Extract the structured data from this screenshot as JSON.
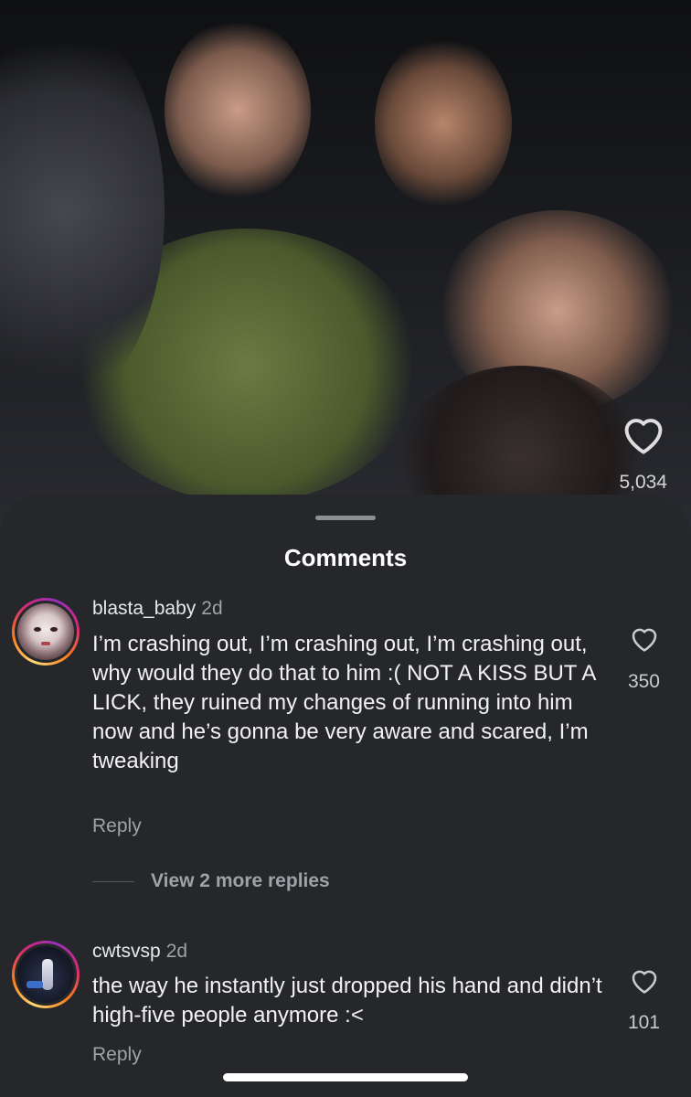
{
  "video": {
    "like_count": "5,034",
    "like_icon": "heart-outline-icon"
  },
  "sheet": {
    "title": "Comments"
  },
  "comments": [
    {
      "username": "blasta_baby",
      "time": "2d",
      "text": "I’m crashing out, I’m crashing out, I’m crashing out, why would they do that to him :( NOT A KISS BUT A LICK, they ruined my changes of running into him now and he’s gonna be very aware and scared, I’m tweaking",
      "likes": "350",
      "reply_label": "Reply",
      "view_replies_label": "View 2 more replies"
    },
    {
      "username": "cwtsvsp",
      "time": "2d",
      "text": "the way he instantly just dropped his hand and didn’t high-five people anymore :<",
      "likes": "101",
      "reply_label": "Reply"
    }
  ]
}
